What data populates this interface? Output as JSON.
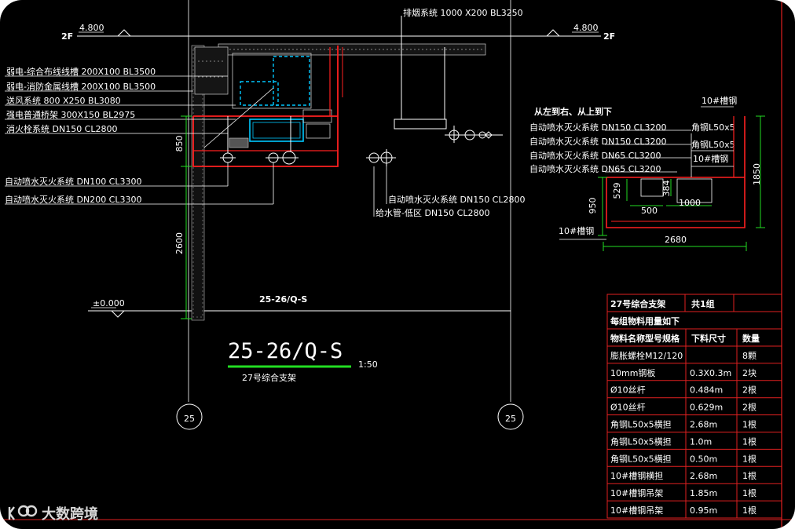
{
  "elevations": {
    "left_floor": "2F",
    "left_level": "4.800",
    "right_floor": "2F",
    "right_level": "4.800",
    "ground_level": "±0.000"
  },
  "top_label": "排烟系统 1000 X200 BL3250",
  "left_labels": [
    "弱电-综合布线线槽 200X100  BL3500",
    "弱电-消防金属线槽 200X100  BL3500",
    "送风系统 800 X250 BL3080",
    "强电普通桥架 300X150  BL2975",
    "消火栓系统  DN150  CL2800"
  ],
  "lower_left_labels": [
    "自动喷水灭火系统  DN100  CL3300",
    "自动喷水灭火系统  DN200  CL3300"
  ],
  "center_labels": [
    "自动喷水灭火系统  DN150  CL2800",
    "给水管-低区  DN150  CL2800"
  ],
  "detail_header": "从左到右、从上到下",
  "detail_labels": [
    "自动喷水灭火系统  DN150  CL3200",
    "自动喷水灭火系统  DN150  CL3200",
    "自动喷水灭火系统  DN65  CL3200",
    "自动喷水灭火系统  DN65  CL3200"
  ],
  "detail_notes": {
    "channel_top": "10#槽钢",
    "angle_1": "角钢L50x5",
    "angle_2": "角钢L50x5",
    "channel_mid": "10#槽钢",
    "channel_bottom": "10#槽钢"
  },
  "dimensions": {
    "main_850": "850",
    "main_2600": "2600",
    "detail_1850": "1850",
    "detail_950": "950",
    "detail_529": "529",
    "detail_384": "384",
    "detail_500": "500",
    "detail_1000": "1000",
    "detail_2680": "2680"
  },
  "section_small": "25-26/Q-S",
  "section_title": "25-26/Q-S",
  "section_scale": "1:50",
  "section_subtitle": "27号综合支架",
  "grid_axis_left": "25",
  "grid_axis_right": "25",
  "table": {
    "title": "27号综合支架",
    "group": "共1组",
    "note": "每组物料用量如下",
    "headers": [
      "物料名称型号规格",
      "下料尺寸",
      "数量"
    ],
    "rows": [
      [
        "膨胀螺栓M12/120",
        "",
        "8颗"
      ],
      [
        "10mm钢板",
        "0.3X0.3m",
        "2块"
      ],
      [
        "Ø10丝杆",
        "0.484m",
        "2根"
      ],
      [
        "Ø10丝杆",
        "0.629m",
        "2根"
      ],
      [
        "角钢L50x5横担",
        "2.68m",
        "1根"
      ],
      [
        "角钢L50x5横担",
        "1.0m",
        "1根"
      ],
      [
        "角钢L50x5横担",
        "0.50m",
        "1根"
      ],
      [
        "10#槽钢横担",
        "2.68m",
        "1根"
      ],
      [
        "10#槽钢吊架",
        "1.85m",
        "1根"
      ],
      [
        "10#槽钢吊架",
        "0.95m",
        "1根"
      ]
    ]
  },
  "watermark": "大数跨境",
  "colors": {
    "background": "#000000",
    "line": "#ffffff",
    "red": "#ff2020",
    "green": "#22dd22",
    "cyan": "#00c8ff",
    "frame": "#e02020"
  }
}
